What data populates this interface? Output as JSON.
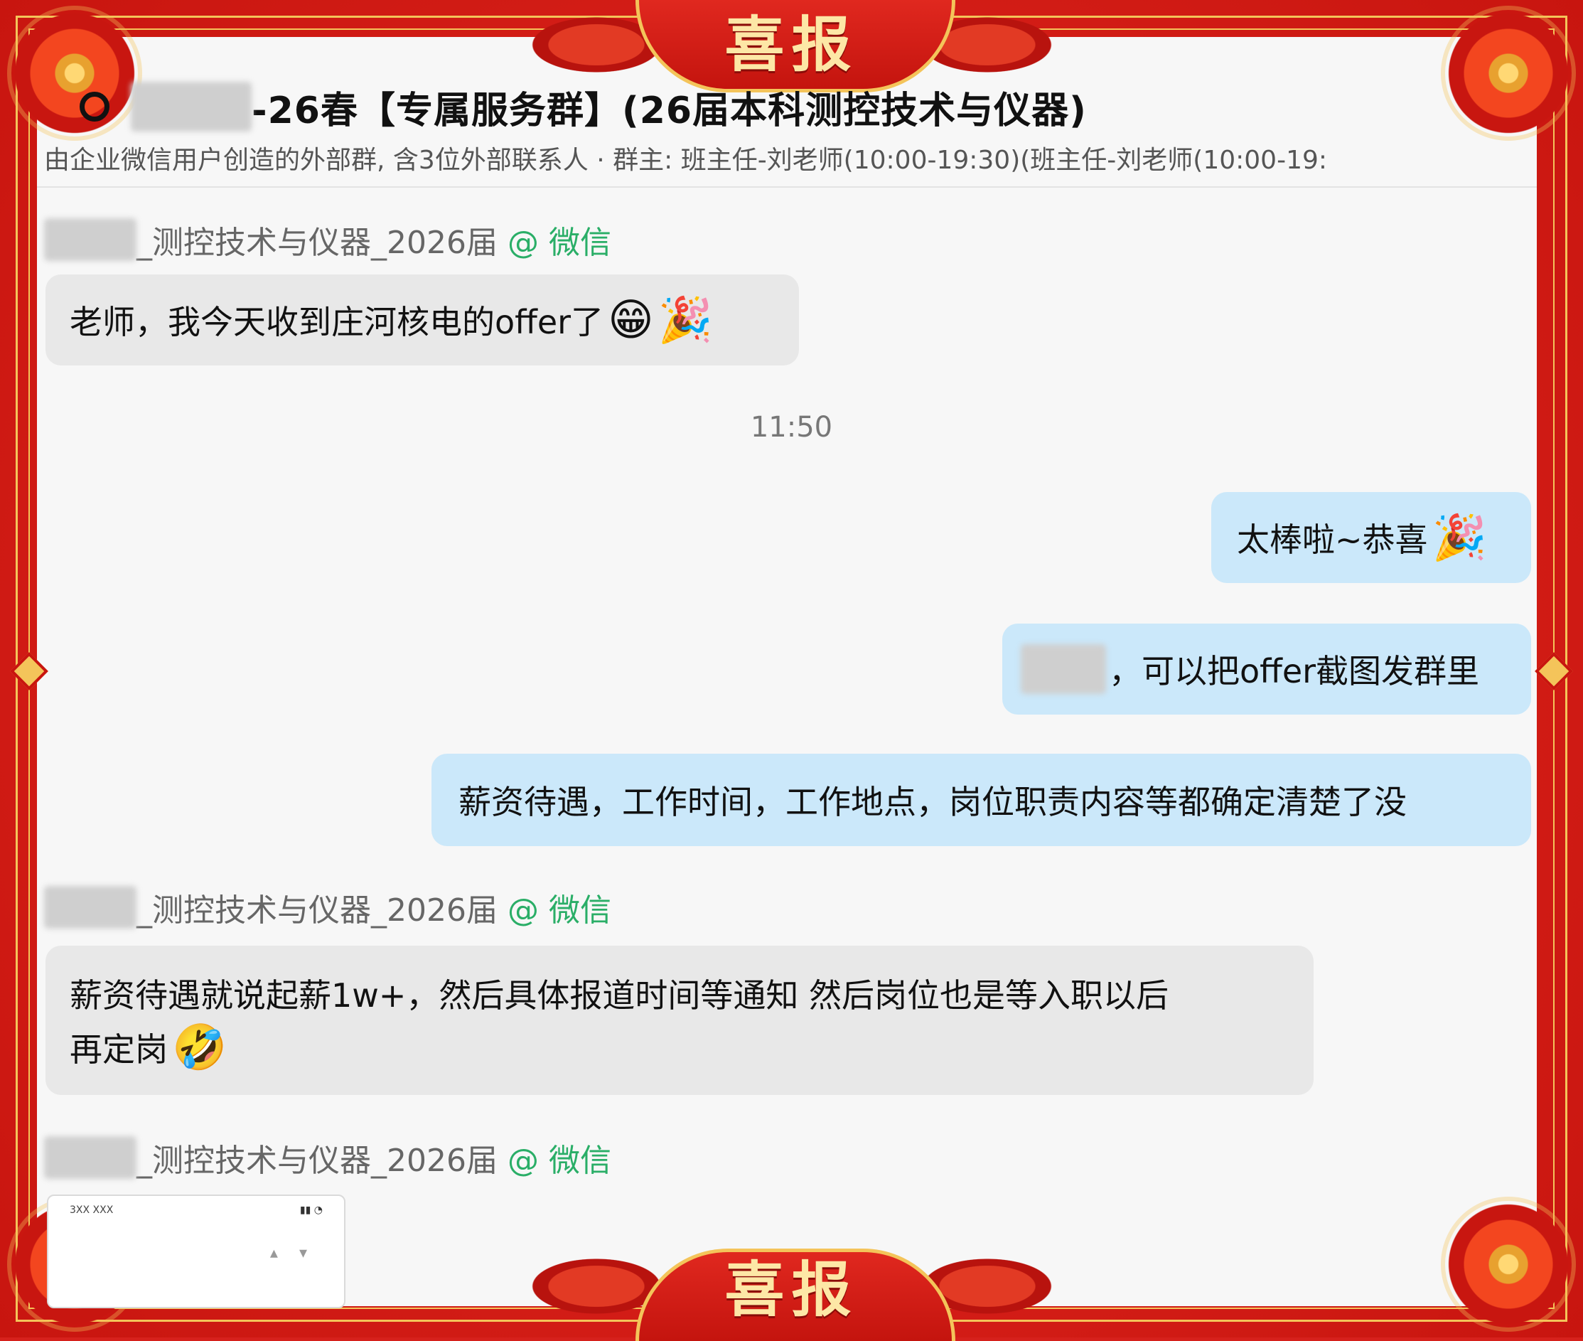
{
  "banner": {
    "top_text": "喜报",
    "bottom_text": "喜报"
  },
  "header": {
    "title": "-26春【专属服务群】(26届本科测控技术与仪器)",
    "subtitle": "由企业微信用户创造的外部群, 含3位外部联系人 · 群主: 班主任-刘老师(10:00-19:30)(班主任-刘老师(10:00-19:"
  },
  "sender_label": {
    "name_suffix": "_测控技术与仪器_2026届",
    "platform": "@ 微信"
  },
  "messages": [
    {
      "text": "老师，我今天收到庄河核电的offer了",
      "emoji": "grinning-face, party-popper"
    },
    {
      "text": "太棒啦~恭喜",
      "emoji": "party-popper"
    },
    {
      "text": "，可以把offer截图发群里"
    },
    {
      "text": "薪资待遇，工作时间，工作地点，岗位职责内容等都确定清楚了没"
    },
    {
      "text_line1": "薪资待遇就说起薪1w+，然后具体报道时间等通知 然后岗位也是等入职以后",
      "text_line2": "再定岗",
      "emoji": "rolling-on-floor-laughing"
    }
  ],
  "timestamp": "11:50",
  "thumbnail": {
    "status_left": "3XX XXX",
    "status_right": "▴▾"
  },
  "colors": {
    "frame_red": "#d6211c",
    "gold": "#f4c45a",
    "incoming_bubble": "#e8e8e8",
    "outgoing_bubble": "#cbe8fa",
    "wechat_green": "#2aae67"
  }
}
